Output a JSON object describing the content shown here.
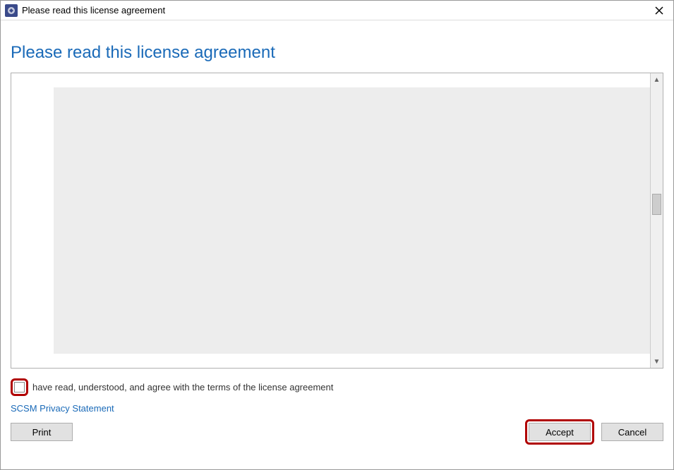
{
  "titlebar": {
    "title": "Please read this license agreement"
  },
  "heading": "Please read this license agreement",
  "checkbox": {
    "label": "have read, understood, and agree with the terms of the license agreement",
    "checked": false
  },
  "privacyLink": "SCSM Privacy Statement",
  "buttons": {
    "print": "Print",
    "accept": "Accept",
    "cancel": "Cancel"
  }
}
